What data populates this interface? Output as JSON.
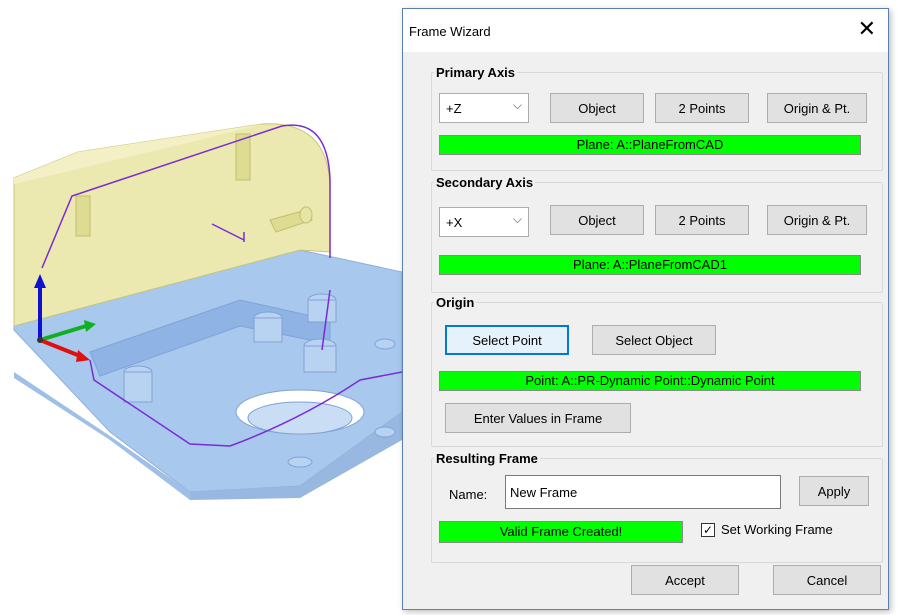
{
  "dialog": {
    "title": "Frame Wizard",
    "close_glyph": "✕"
  },
  "primary_axis": {
    "legend": "Primary Axis",
    "combo_value": "+Z",
    "object_label": "Object",
    "two_points_label": "2 Points",
    "origin_pt_label": "Origin & Pt.",
    "status": "Plane: A::PlaneFromCAD"
  },
  "secondary_axis": {
    "legend": "Secondary Axis",
    "combo_value": "+X",
    "object_label": "Object",
    "two_points_label": "2 Points",
    "origin_pt_label": "Origin & Pt.",
    "status": "Plane: A::PlaneFromCAD1"
  },
  "origin": {
    "legend": "Origin",
    "select_point_label": "Select Point",
    "select_object_label": "Select Object",
    "status": "Point: A::PR-Dynamic Point::Dynamic Point",
    "enter_values_label": "Enter Values in Frame"
  },
  "resulting_frame": {
    "legend": "Resulting Frame",
    "name_label": "Name:",
    "name_value": "New Frame",
    "apply_label": "Apply",
    "status": "Valid Frame Created!",
    "set_working_label": "Set Working Frame",
    "set_working_checked": true
  },
  "footer": {
    "accept_label": "Accept",
    "cancel_label": "Cancel"
  },
  "colors": {
    "status_green": "#00ff00",
    "part_yellow": "#e8e6a8",
    "part_blue": "#a9c8ee",
    "outline_purple": "#7a2bd6",
    "axis_x": "#e01010",
    "axis_y": "#10b020",
    "axis_z": "#1010d0"
  }
}
